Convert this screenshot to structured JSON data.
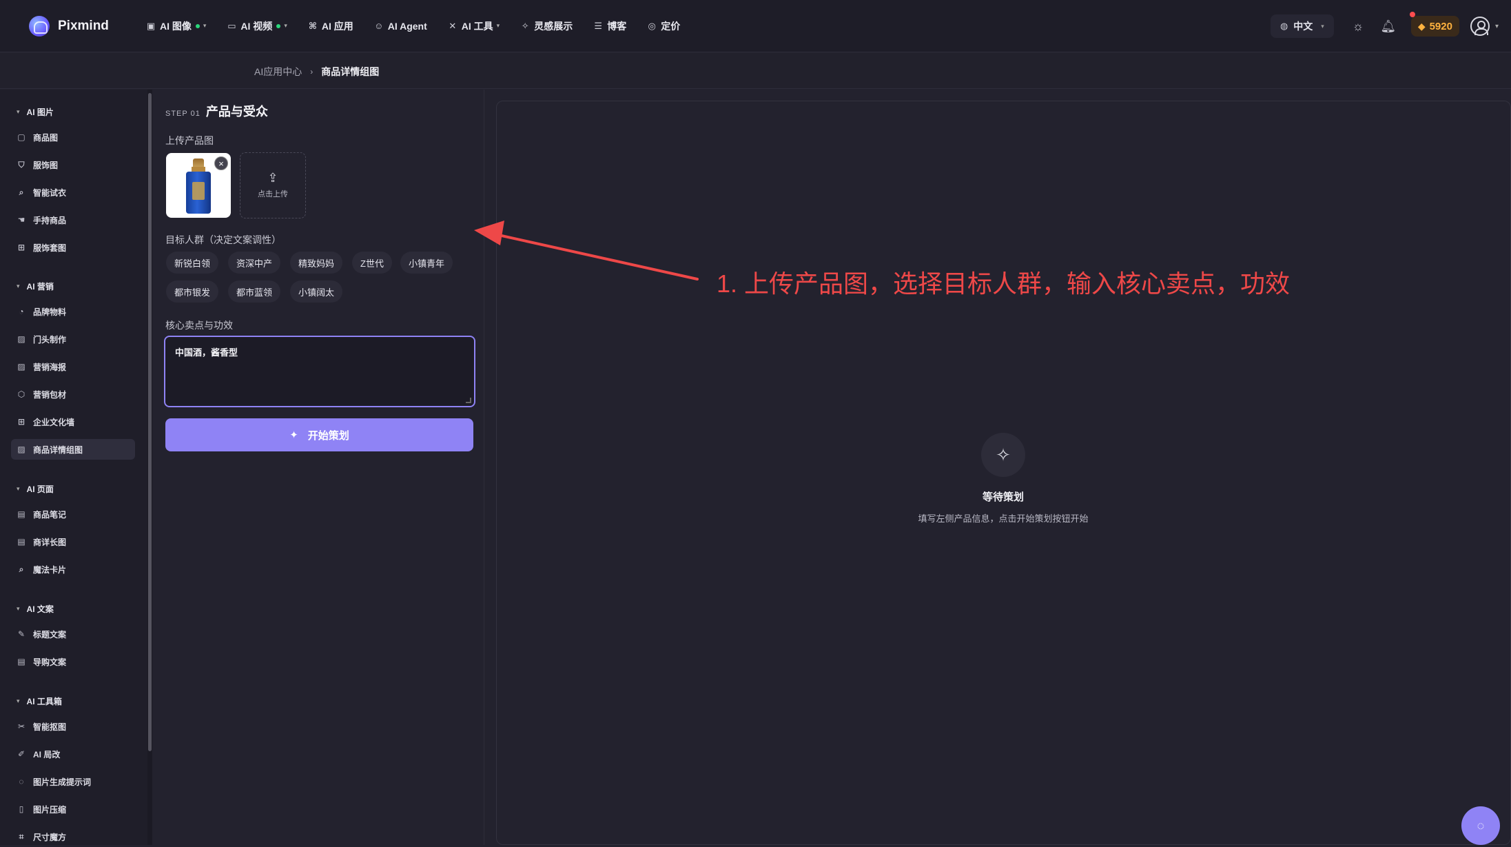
{
  "brand": {
    "name": "Pixmind"
  },
  "nav": [
    {
      "label": "AI 图像",
      "icon": "image-icon",
      "dot": true,
      "chevron": true
    },
    {
      "label": "AI 视频",
      "icon": "video-icon",
      "dot": true,
      "chevron": true
    },
    {
      "label": "AI 应用",
      "icon": "apps-icon",
      "dot": false,
      "chevron": false
    },
    {
      "label": "AI Agent",
      "icon": "robot-icon",
      "dot": false,
      "chevron": false
    },
    {
      "label": "AI 工具",
      "icon": "tools-icon",
      "dot": false,
      "chevron": true
    },
    {
      "label": "灵感展示",
      "icon": "sparkle-icon",
      "dot": false,
      "chevron": false
    },
    {
      "label": "博客",
      "icon": "blog-icon",
      "dot": false,
      "chevron": false
    },
    {
      "label": "定价",
      "icon": "pricing-icon",
      "dot": false,
      "chevron": false
    }
  ],
  "header": {
    "language": "中文",
    "credits": "5920"
  },
  "breadcrumb": {
    "parent": "AI应用中心",
    "current": "商品详情组图"
  },
  "sidebar": {
    "groups": [
      {
        "title": "AI 图片",
        "items": [
          {
            "label": "商品图",
            "icon": "product-icon"
          },
          {
            "label": "服饰图",
            "icon": "shirt-icon"
          },
          {
            "label": "智能试衣",
            "icon": "try-on-icon"
          },
          {
            "label": "手持商品",
            "icon": "hand-icon"
          },
          {
            "label": "服饰套图",
            "icon": "grid-icon"
          }
        ]
      },
      {
        "title": "AI 营销",
        "items": [
          {
            "label": "品牌物料",
            "icon": "palette-icon"
          },
          {
            "label": "门头制作",
            "icon": "storefront-icon"
          },
          {
            "label": "营销海报",
            "icon": "poster-icon"
          },
          {
            "label": "营销包材",
            "icon": "box-icon"
          },
          {
            "label": "企业文化墙",
            "icon": "wall-icon"
          },
          {
            "label": "商品详情组图",
            "icon": "detail-image-icon",
            "active": true
          }
        ]
      },
      {
        "title": "AI 页面",
        "items": [
          {
            "label": "商品笔记",
            "icon": "note-icon"
          },
          {
            "label": "商详长图",
            "icon": "long-image-icon"
          },
          {
            "label": "魔法卡片",
            "icon": "magic-card-icon"
          }
        ]
      },
      {
        "title": "AI 文案",
        "items": [
          {
            "label": "标题文案",
            "icon": "pen-icon"
          },
          {
            "label": "导购文案",
            "icon": "doc-icon"
          }
        ]
      },
      {
        "title": "AI 工具箱",
        "items": [
          {
            "label": "智能抠图",
            "icon": "scissors-icon"
          },
          {
            "label": "AI 局改",
            "icon": "brush-icon"
          },
          {
            "label": "图片生成提示词",
            "icon": "bulb-icon"
          },
          {
            "label": "图片压缩",
            "icon": "compress-icon"
          },
          {
            "label": "尺寸魔方",
            "icon": "crop-icon"
          }
        ]
      }
    ]
  },
  "form": {
    "step_tag": "STEP 01",
    "step_title": "产品与受众",
    "upload_label": "上传产品图",
    "upload_button": "点击上传",
    "audience_label": "目标人群（决定文案调性）",
    "audience_options": [
      "新锐白领",
      "资深中产",
      "精致妈妈",
      "Z世代",
      "小镇青年",
      "都市银发",
      "都市蓝领",
      "小镇阔太"
    ],
    "selling_label": "核心卖点与功效",
    "selling_value": "中国酒，酱香型",
    "start_button": "开始策划"
  },
  "preview": {
    "title": "等待策划",
    "subtitle": "填写左侧产品信息，点击开始策划按钮开始"
  },
  "annotation": {
    "text": "1. 上传产品图，选择目标人群，输入核心卖点，功效",
    "color": "#ee4848"
  },
  "colors": {
    "accent": "#8f83f5",
    "credits": "#ffb23f",
    "status_dot": "#2bd67b"
  }
}
